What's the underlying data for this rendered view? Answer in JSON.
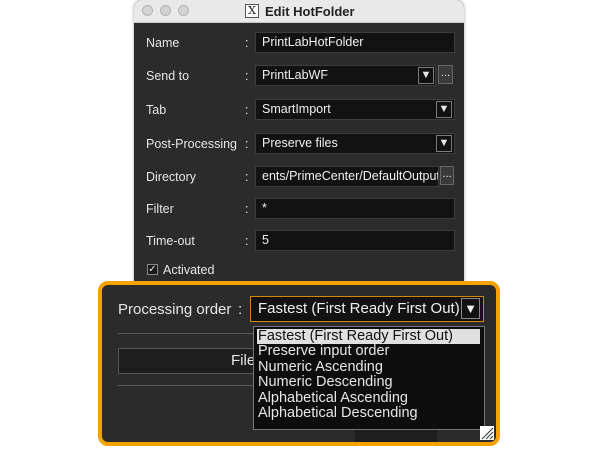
{
  "window": {
    "title": "Edit HotFolder",
    "app_icon": "x11-icon",
    "app_icon_glyph": "X"
  },
  "form": {
    "name_label": "Name",
    "name_value": "PrintLabHotFolder",
    "sendto_label": "Send to",
    "sendto_value": "PrintLabWF",
    "tab_label": "Tab",
    "tab_value": "SmartImport",
    "post_label": "Post-Processing",
    "post_value": "Preserve files",
    "dir_label": "Directory",
    "dir_value": "ents/PrimeCenter/DefaultOutput",
    "filter_label": "Filter",
    "filter_value": "*",
    "timeout_label": "Time-out",
    "timeout_value": "5",
    "activated_label": "Activated",
    "activated_checked": true,
    "colon": ":",
    "dropdown_glyph": "▼",
    "browse_glyph": "..."
  },
  "zoom": {
    "label": "Processing order",
    "colon": ":",
    "value": "Fastest (First Ready First Out)",
    "dropdown_glyph": "▼",
    "button_label_partial": "File",
    "options": [
      "Fastest (First Ready First Out)",
      "Preserve input order",
      "Numeric Ascending",
      "Numeric Descending",
      "Alphabetical Ascending",
      "Alphabetical Descending"
    ],
    "selected_index": 0,
    "highlight_color": "#f5a100"
  }
}
